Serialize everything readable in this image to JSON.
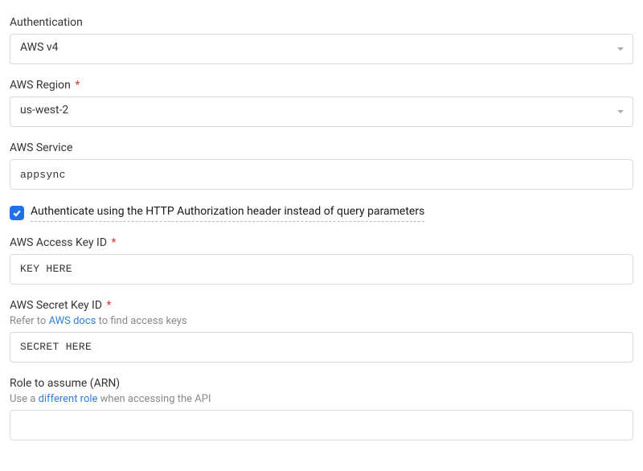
{
  "authentication": {
    "label": "Authentication",
    "value": "AWS v4"
  },
  "aws_region": {
    "label": "AWS Region",
    "value": "us-west-2"
  },
  "aws_service": {
    "label": "AWS Service",
    "value": "appsync"
  },
  "http_header_checkbox": {
    "label": "Authenticate using the HTTP Authorization header instead of query parameters",
    "checked": true
  },
  "access_key": {
    "label": "AWS Access Key ID",
    "value": "KEY HERE"
  },
  "secret_key": {
    "label": "AWS Secret Key ID",
    "helper_prefix": "Refer to ",
    "helper_link": "AWS docs",
    "helper_suffix": " to find access keys",
    "value": "SECRET HERE"
  },
  "role_arn": {
    "label": "Role to assume (ARN)",
    "helper_prefix": "Use a ",
    "helper_link": "different role",
    "helper_suffix": " when accessing the API",
    "value": ""
  }
}
